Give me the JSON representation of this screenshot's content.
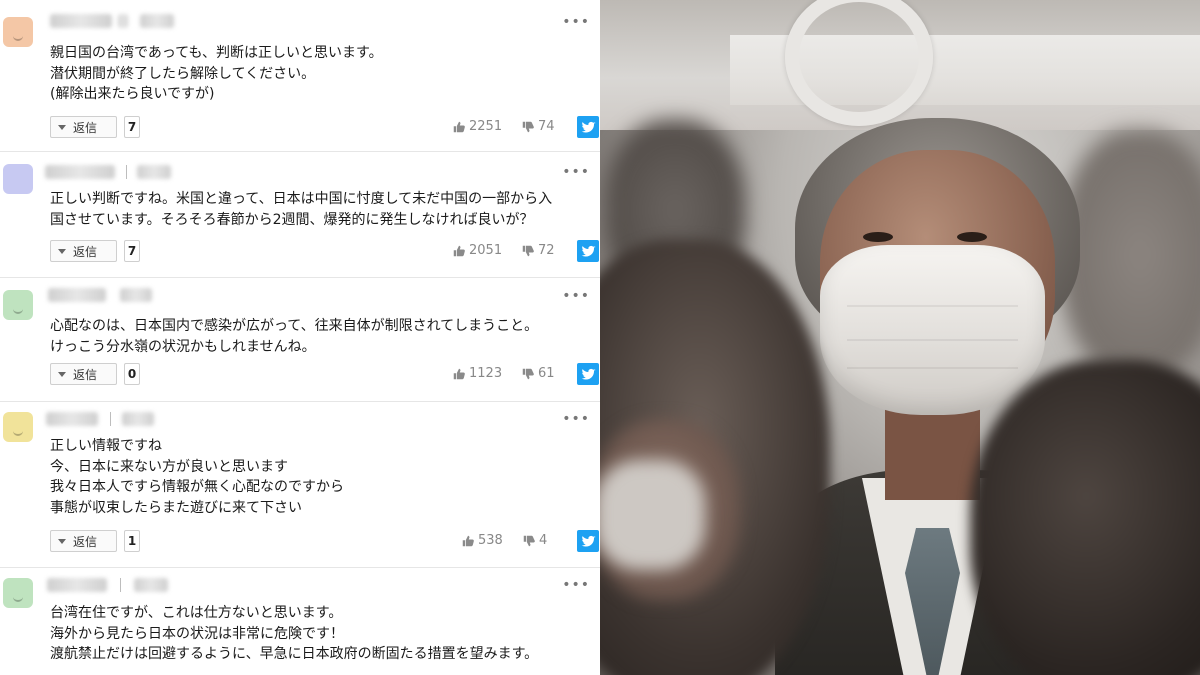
{
  "comments": [
    {
      "avatar_color": "#f4c7a6",
      "text": "親日国の台湾であっても、判断は正しいと思います。\n潜伏期間が終了したら解除してください。\n(解除出来たら良いですが)",
      "reply_label": "返信",
      "reply_count": "7",
      "likes": "2251",
      "dislikes": "74",
      "more": "•••"
    },
    {
      "avatar_color": "#c7c9f2",
      "text": "正しい判断ですね。米国と違って、日本は中国に忖度して未だ中国の一部から入\n国させています。そろそろ春節から2週間、爆発的に発生しなければ良いが？",
      "reply_label": "返信",
      "reply_count": "7",
      "likes": "2051",
      "dislikes": "72",
      "more": "•••"
    },
    {
      "avatar_color": "#bfe3bf",
      "text": "心配なのは、日本国内で感染が広がって、往来自体が制限されてしまうこと。\nけっこう分水嶺の状況かもしれませんね。",
      "reply_label": "返信",
      "reply_count": "0",
      "likes": "1123",
      "dislikes": "61",
      "more": "•••"
    },
    {
      "avatar_color": "#f1e39a",
      "text": "正しい情報ですね\n今、日本に来ない方が良いと思います\n我々日本人ですら情報が無く心配なのですから\n事態が収束したらまた遊びに来て下さい",
      "reply_label": "返信",
      "reply_count": "1",
      "likes": "538",
      "dislikes": "4",
      "more": "•••"
    },
    {
      "avatar_color": "#bfe3bf",
      "text": "台湾在住ですが、これは仕方ないと思います。\n海外から見たら日本の状況は非常に危険です！\n渡航禁止だけは回避するように、早急に日本政府の断固たる措置を望みます。",
      "more": "•••"
    }
  ],
  "colors": {
    "twitter": "#1da1f2",
    "like_gray": "#8a8a8a"
  },
  "icons": {
    "like": "thumbs-up-icon",
    "dislike": "thumbs-down-icon",
    "share": "twitter-icon",
    "reply": "caret-down-icon"
  }
}
